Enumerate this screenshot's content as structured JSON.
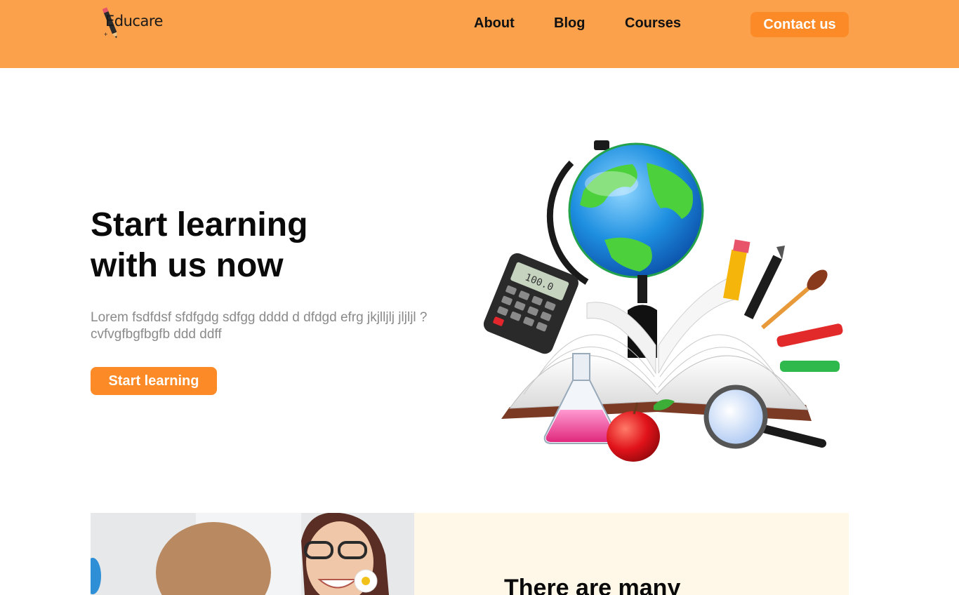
{
  "header": {
    "logo_text": "Educare",
    "nav": {
      "about": "About",
      "blog": "Blog",
      "courses": "Courses"
    },
    "contact_label": "Contact us",
    "background": "#fba14b",
    "accent": "#fc8a26"
  },
  "hero": {
    "title_line1": "Start learning",
    "title_line2": "with us now",
    "description": "Lorem fsdfdsf sfdfgdg sdfgg dddd d dfdgd efrg jkjlljlj jljljl ? cvfvgfbgfbgfb ddd ddff",
    "cta_label": "Start learning",
    "illustration_icon": "school-supplies-illustration",
    "calculator_display": "100.0"
  },
  "feature": {
    "heading": "There are many",
    "panel_color": "#fff7e7",
    "photo_icon": "teacher-child-photo"
  }
}
